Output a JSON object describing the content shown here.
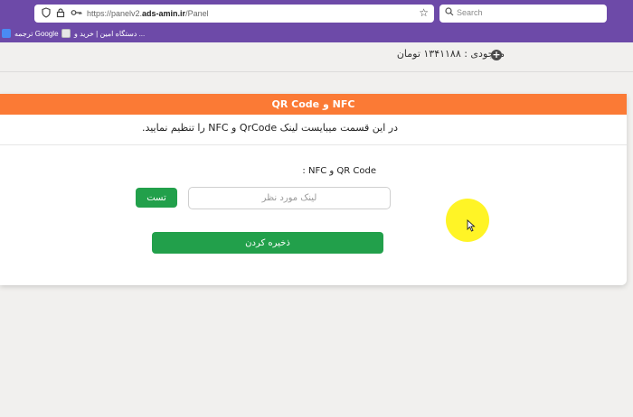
{
  "browser": {
    "url_prefix": "https://panelv2.",
    "url_domain": "ads-amin.ir",
    "url_path": "/Panel",
    "search_placeholder": "Search",
    "bookmarks": [
      {
        "label": "ترجمه Google",
        "icon": "google-translate-icon"
      },
      {
        "label": "دستگاه امین | خرید و ...",
        "icon": "site-favicon"
      }
    ]
  },
  "header": {
    "balance_text": "موجودی : ۱۳۴۱۱۸۸ تومان",
    "add_icon": "plus-circle-icon"
  },
  "card": {
    "title": "NFC و QR Code",
    "description": "در این قسمت میبایست لینک QrCode و NFC را تنظیم نمایید.",
    "field_label": "QR Code و NFC :",
    "link_input": {
      "placeholder": "لینک مورد نظر",
      "value": ""
    },
    "test_button": "تست",
    "save_button": "ذخیره کردن"
  },
  "colors": {
    "browser_chrome": "#6d4aa8",
    "header_orange": "#fb7a35",
    "button_green": "#22a04b",
    "cursor_highlight": "#fff200"
  }
}
